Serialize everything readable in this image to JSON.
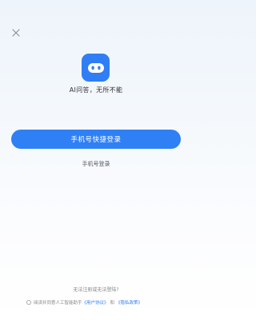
{
  "app": {
    "slogan": "AI问答，无所不能",
    "accent": "#2f7ef5"
  },
  "close": {
    "icon": "close-icon"
  },
  "login": {
    "primary_label": "手机号快捷登录",
    "secondary_label": "手机号登录"
  },
  "footer": {
    "help": "无法注册或无法登陆?",
    "agreement_prefix": "阅读并同意人工智能助手",
    "user_agreement": "《用户协议》",
    "and": "和",
    "privacy_policy": "《隐私政策》"
  }
}
